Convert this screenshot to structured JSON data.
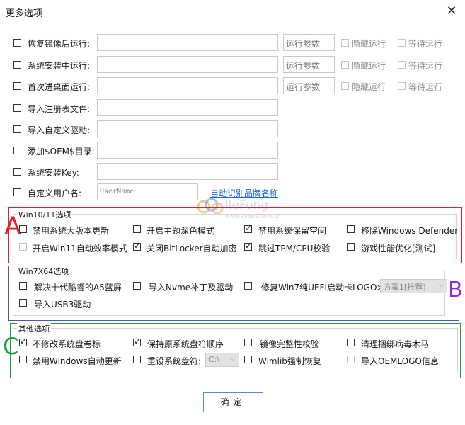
{
  "window": {
    "title": "更多选项",
    "close_glyph": "✕"
  },
  "top_rows": [
    {
      "label": "恢复镜像后运行:",
      "param": "运行参数",
      "hide": "隐藏运行",
      "wait": "等待运行"
    },
    {
      "label": "系统安装中运行:",
      "param": "运行参数",
      "hide": "隐藏运行",
      "wait": "等待运行"
    },
    {
      "label": "首次进桌面运行:",
      "param": "运行参数",
      "hide": "隐藏运行",
      "wait": "等待运行"
    }
  ],
  "simple_rows": [
    {
      "label": "导入注册表文件:"
    },
    {
      "label": "导入自定义驱动:"
    },
    {
      "label": "添加$OEM$目录:"
    },
    {
      "label": "系统安装Key:"
    }
  ],
  "user_row": {
    "label": "自定义用户名:",
    "placeholder": "UserName",
    "link": "自动识别品牌名称"
  },
  "watermark": {
    "text": "lleFong",
    "sub": "www.99689.com.cn"
  },
  "win1011": {
    "title": "Win10/11选项",
    "letter": "A",
    "items": [
      {
        "label": "禁用系统大版本更新",
        "checked": false,
        "disabled": false
      },
      {
        "label": "开启主题深色模式",
        "checked": false,
        "disabled": false
      },
      {
        "label": "禁用系统保留空间",
        "checked": true,
        "disabled": false
      },
      {
        "label": "移除Windows Defender",
        "checked": false,
        "disabled": false
      },
      {
        "label": "开启Win11自动效率模式",
        "checked": false,
        "disabled": true
      },
      {
        "label": "关闭BitLocker自动加密",
        "checked": true,
        "disabled": false
      },
      {
        "label": "跳过TPM/CPU校验",
        "checked": true,
        "disabled": false
      },
      {
        "label": "游戏性能优化[测试]",
        "checked": false,
        "disabled": false
      }
    ]
  },
  "win7": {
    "title": "Win7X64选项",
    "letter": "B",
    "items": [
      {
        "label": "解决十代酷睿的A5蓝屏",
        "checked": false
      },
      {
        "label": "导入Nvme补丁及驱动",
        "checked": false
      },
      {
        "label": "修复Win7纯UEFI启动卡LOGO>>",
        "checked": false
      },
      {
        "label": "导入USB3驱动",
        "checked": false
      }
    ],
    "select_value": "方案1[推荐]"
  },
  "other": {
    "title": "其他选项",
    "letter": "C",
    "items": [
      {
        "label": "不修改系统盘卷标",
        "checked": true,
        "disabled": false
      },
      {
        "label": "保持原系统盘符顺序",
        "checked": true,
        "disabled": false
      },
      {
        "label": "镜像完整性校验",
        "checked": false,
        "disabled": false
      },
      {
        "label": "清理捆绑病毒木马",
        "checked": false,
        "disabled": false
      },
      {
        "label": "禁用Windows自动更新",
        "checked": false,
        "disabled": false
      },
      {
        "label": "重设系统盘符:",
        "checked": false,
        "disabled": false
      },
      {
        "label": "Wimlib强制恢复",
        "checked": false,
        "disabled": false
      },
      {
        "label": "导入OEMLOGO信息",
        "checked": false,
        "disabled": true
      }
    ],
    "drive_value": "C:\\"
  },
  "ok_button": "确定",
  "colors": {
    "A": "#e0202a",
    "B": "#8a2be2",
    "C": "#1aa33a",
    "link": "#1a66d6",
    "ok_border": "#4a90d9"
  }
}
